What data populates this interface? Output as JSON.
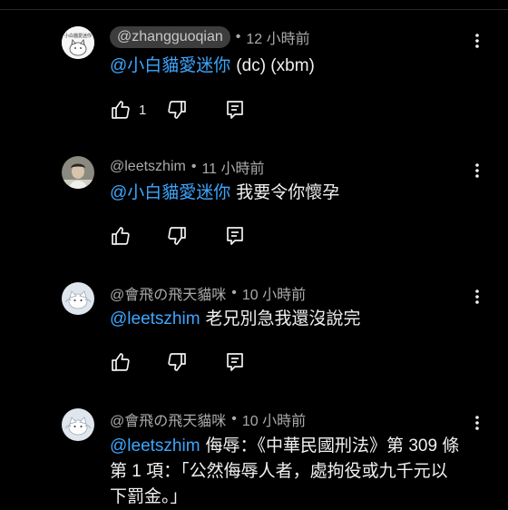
{
  "comments": [
    {
      "handle": "@zhangguoqian",
      "highlighted": true,
      "time": "12 小時前",
      "mention": "@小白貓愛迷你",
      "text": "(dc) (xbm)",
      "likes": "1",
      "avatar_icon": "white-cat-avatar-icon"
    },
    {
      "handle": "@leetszhim",
      "highlighted": false,
      "time": "11 小時前",
      "mention": "@小白貓愛迷你",
      "text": "我要令你懷孕",
      "likes": "",
      "avatar_icon": "person-avatar-icon"
    },
    {
      "handle": "@會飛の飛天貓咪",
      "highlighted": false,
      "time": "10 小時前",
      "mention": "@leetszhim",
      "text": "老兄別急我還沒說完",
      "likes": "",
      "avatar_icon": "flying-cat-avatar-icon"
    },
    {
      "handle": "@會飛の飛天貓咪",
      "highlighted": false,
      "time": "10 小時前",
      "mention": "@leetszhim",
      "text": "侮辱：《中華民國刑法》第 309 條第 1 項：「公然侮辱人者，處拘役或九千元以下罰金。」",
      "likes": "",
      "avatar_icon": "flying-cat-avatar-icon"
    }
  ],
  "separator": "•",
  "icons": {
    "like": "thumbs-up-icon",
    "dislike": "thumbs-down-icon",
    "reply": "reply-icon",
    "menu": "more-vert-icon"
  },
  "colors": {
    "background": "#000000",
    "mention": "#3ea6ff",
    "meta": "#aaaaaa",
    "highlight_pill": "#3d3d3d"
  }
}
